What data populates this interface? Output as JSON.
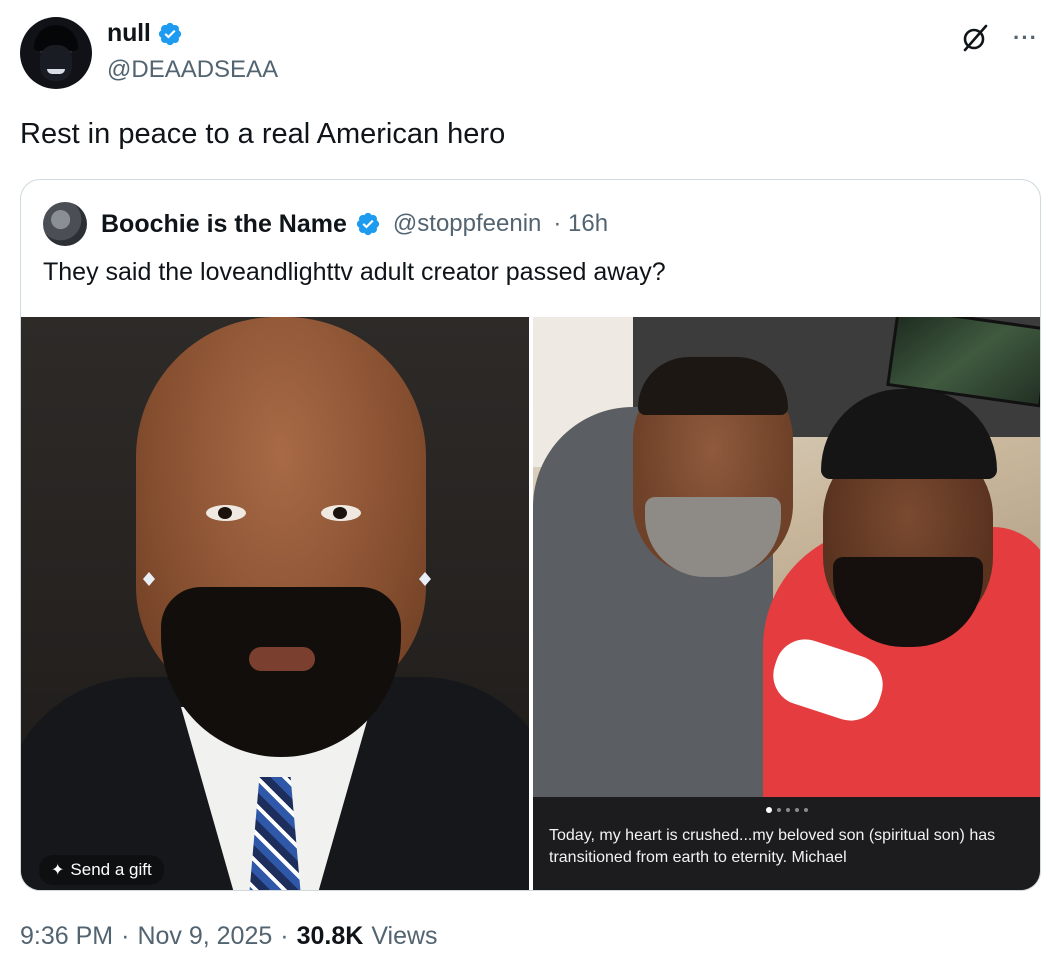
{
  "tweet": {
    "display_name": "null",
    "handle": "@DEAADSEAA",
    "text": "Rest in peace to a real American hero",
    "time": "9:36 PM",
    "date": "Nov 9, 2025",
    "views_count": "30.8K",
    "views_label": "Views",
    "sep": "·"
  },
  "quote": {
    "display_name": "Boochie is the Name",
    "handle": "@stoppfeenin",
    "age": "· 16h",
    "text": "They said the loveandlighttv adult creator passed away?"
  },
  "media": {
    "gift_label": "Send a gift",
    "caption": "Today, my heart is crushed...my beloved son (spiritual son) has transitioned from earth to eternity.  Michael"
  },
  "icons": {
    "verified": "verified-badge-icon",
    "grok": "grok-icon",
    "more": "more-icon",
    "gift": "gift-icon"
  },
  "colors": {
    "verified": "#1d9bf0",
    "text_primary": "#0f1419",
    "text_secondary": "#536471",
    "border": "#cfd9de"
  }
}
